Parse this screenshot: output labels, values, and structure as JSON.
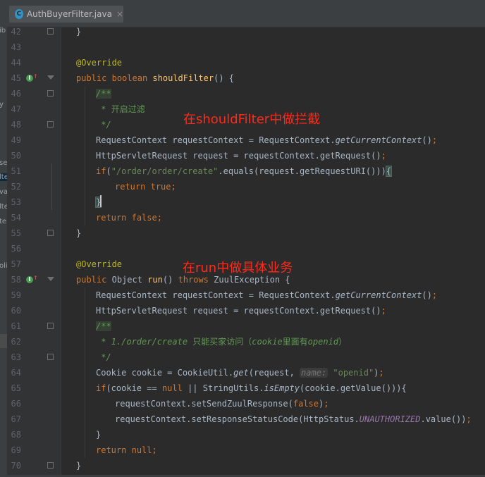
{
  "tab": {
    "icon": "C",
    "title": "AuthBuyerFilter.java",
    "close": "×"
  },
  "left_fragments": [
    "ib",
    "y",
    "se",
    "lte",
    "va",
    "lte",
    "ter",
    "oli"
  ],
  "line_numbers": [
    "42",
    "43",
    "44",
    "45",
    "46",
    "47",
    "48",
    "49",
    "50",
    "51",
    "52",
    "53",
    "54",
    "55",
    "56",
    "57",
    "58",
    "59",
    "60",
    "61",
    "62",
    "63",
    "64",
    "65",
    "66",
    "67",
    "68",
    "69",
    "70"
  ],
  "annotations": {
    "should_filter": "在shouldFilter中做拦截",
    "run": "在run中做具体业务"
  },
  "code": {
    "l42": {
      "brace": "}"
    },
    "l44": {
      "annotation": "@Override"
    },
    "l45": {
      "public": "public",
      "boolean": "boolean",
      "method": "shouldFilter",
      "rest": "() {"
    },
    "l46": {
      "doc": "/**"
    },
    "l47": {
      "star": " * ",
      "text": "开启过滤"
    },
    "l48": {
      "end": " */"
    },
    "l49": {
      "type": "RequestContext requestContext = RequestContext.",
      "call": "getCurrentContext",
      "rest": "()",
      "semi": ";"
    },
    "l50": {
      "text": "HttpServletRequest request = requestContext.getRequest()",
      "semi": ";"
    },
    "l51": {
      "if": "if",
      "open": "(",
      "str": "\"/order/order/create\"",
      "mid": ".equals(request.getRequestURI()))",
      "brace": "{"
    },
    "l52": {
      "return": "return",
      "true": "true",
      "semi": ";"
    },
    "l53": {
      "brace": "}"
    },
    "l54": {
      "return": "return",
      "false": "false",
      "semi": ";"
    },
    "l55": {
      "brace": "}"
    },
    "l57": {
      "annotation": "@Override"
    },
    "l58": {
      "public": "public",
      "type": "Object",
      "method": "run",
      "paren": "() ",
      "throws": "throws",
      "rest": " ZuulException {"
    },
    "l59": {
      "type": "RequestContext requestContext = RequestContext.",
      "call": "getCurrentContext",
      "rest": "()",
      "semi": ";"
    },
    "l60": {
      "text": "HttpServletRequest request = requestContext.getRequest()",
      "semi": ";"
    },
    "l61": {
      "doc": "/**"
    },
    "l62": {
      "prefix": " * 1./order/create ",
      "cjk1": "只能买家访问（",
      "cookie": "cookie",
      "cjk2": "里面有",
      "openid": "openid",
      "close": "）"
    },
    "l63": {
      "end": " */"
    },
    "l64": {
      "pre": "Cookie cookie = CookieUtil.",
      "call": "get",
      "args": "(request, ",
      "hint": "name:",
      "str": "\"openid\"",
      "close": ")",
      "semi": ";"
    },
    "l65": {
      "if": "if",
      "a": "(cookie == ",
      "null": "null",
      "b": " || StringUtils.",
      "call": "isEmpty",
      "c": "(cookie.getValue())){"
    },
    "l66": {
      "text": "requestContext.setSendZuulResponse(",
      "false": "false",
      "close": ")",
      "semi": ";"
    },
    "l67": {
      "text": "requestContext.setResponseStatusCode(HttpStatus.",
      "const": "UNAUTHORIZED",
      "rest": ".value())",
      "semi": ";"
    },
    "l68": {
      "brace": "}"
    },
    "l69": {
      "return": "return",
      "null": "null",
      "semi": ";"
    },
    "l70": {
      "brace": "}"
    }
  },
  "colors": {
    "background": "#2b2b2b",
    "keyword": "#cc7832",
    "string": "#6a8759",
    "annotation": "#bbb529",
    "method": "#ffc66d",
    "comment": "#629755",
    "constant": "#9876aa",
    "red_note": "#ff2a1a"
  }
}
